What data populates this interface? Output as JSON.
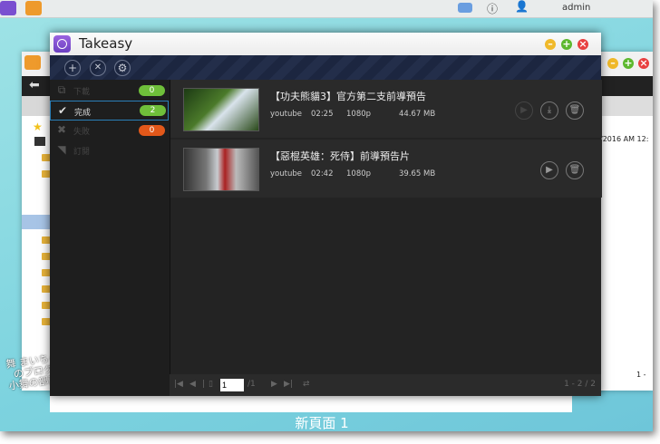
{
  "desktop": {
    "user": "admin",
    "page_label": "新頁面 1",
    "right_window_text": [
      "/2016 AM 12:",
      "1 -"
    ]
  },
  "watermark": {
    "text": "舞 まいちゃんのブログ 小舞の部落格"
  },
  "window": {
    "title": "Takeasy",
    "controls": [
      "minimize",
      "maximize",
      "close"
    ]
  },
  "toolbar": {
    "buttons": [
      {
        "name": "add",
        "glyph": "+"
      },
      {
        "name": "remove",
        "glyph": "✕"
      },
      {
        "name": "settings",
        "glyph": "⚙"
      }
    ]
  },
  "sidebar": {
    "items": [
      {
        "label": "下載",
        "count": "0",
        "icon": "download-icon",
        "color": "#6fbf3a"
      },
      {
        "label": "完成",
        "count": "2",
        "icon": "check-icon",
        "color": "#6fbf3a",
        "selected": true
      },
      {
        "label": "失敗",
        "count": "0",
        "icon": "x-icon",
        "color": "#e2581a"
      },
      {
        "label": "訂閱",
        "icon": "rss-icon"
      }
    ]
  },
  "items": [
    {
      "title": "【功夫熊貓3】官方第二支前導預告",
      "source": "youtube",
      "duration": "02:25",
      "quality": "1080p",
      "size": "44.67 MB"
    },
    {
      "title": "【惡棍英雄：死侍】前導預告片",
      "source": "youtube",
      "duration": "02:42",
      "quality": "1080p",
      "size": "39.65 MB"
    }
  ],
  "pager": {
    "page": "1",
    "total": "/1",
    "range": "1 - 2 / 2"
  }
}
